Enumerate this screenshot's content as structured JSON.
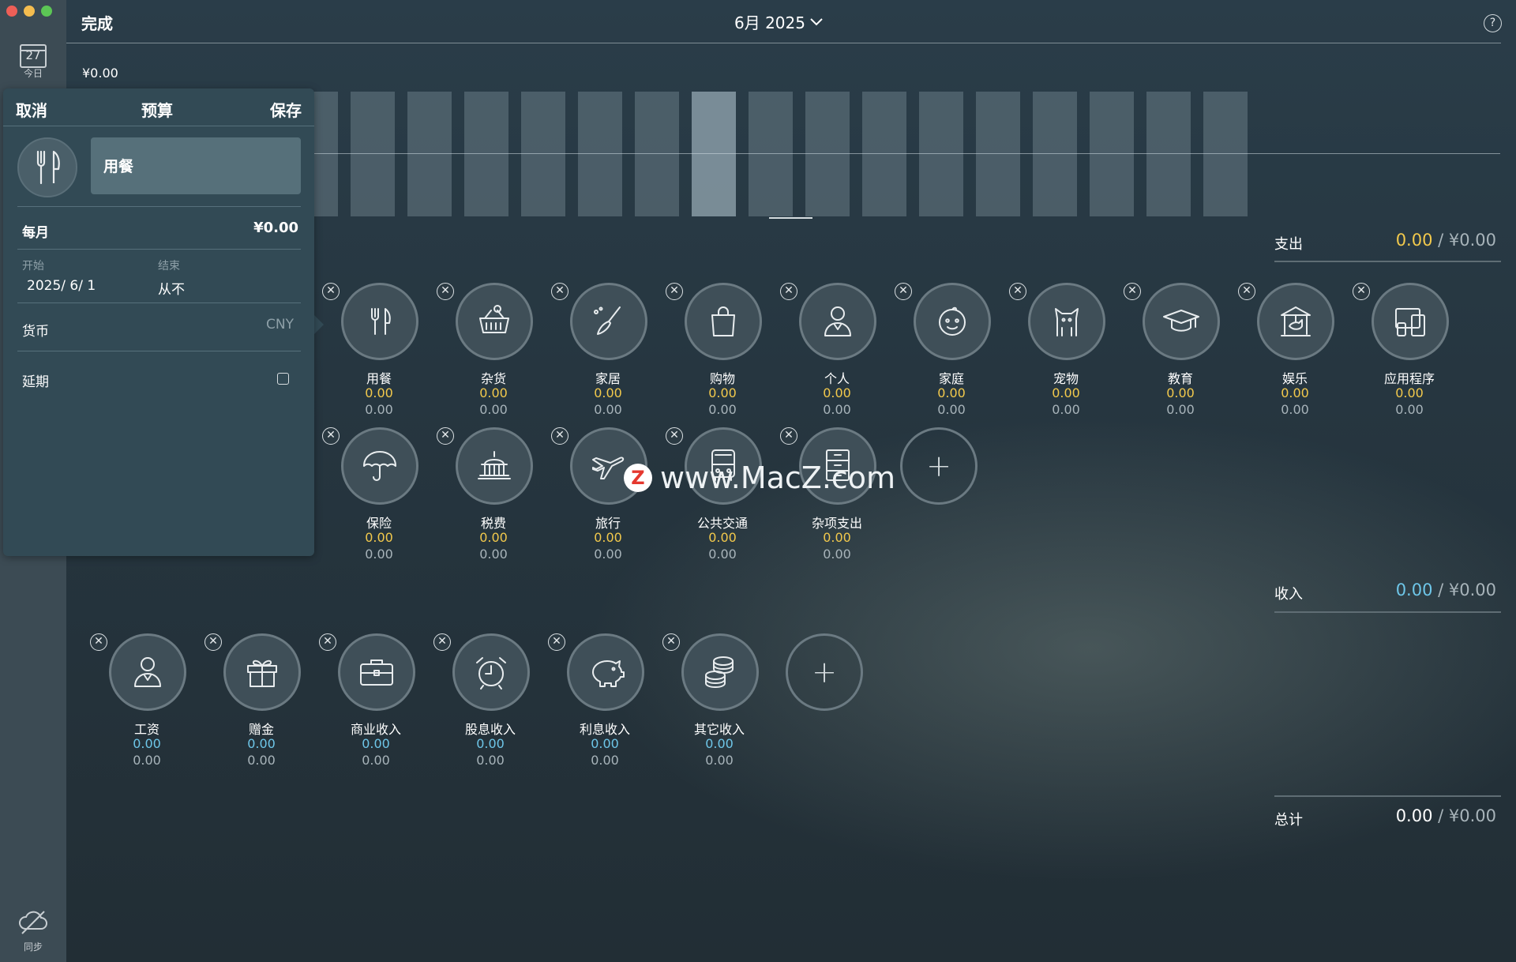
{
  "header": {
    "done_label": "完成",
    "month_label": "6月 2025",
    "help_label": "?"
  },
  "sidebar": {
    "today_day": "27",
    "today_label": "今日",
    "sync_label": "同步"
  },
  "daily_total": "¥0.00",
  "summary": {
    "expense": {
      "label": "支出",
      "spent": "0.00",
      "budget": " / ¥0.00"
    },
    "income": {
      "label": "收入",
      "spent": "0.00",
      "budget": " / ¥0.00"
    },
    "total": {
      "label": "总计",
      "spent": "0.00",
      "budget": " / ¥0.00"
    }
  },
  "expense_categories": [
    {
      "name": "用餐",
      "icon": "fork-knife-icon",
      "v1": "0.00",
      "v2": "0.00"
    },
    {
      "name": "杂货",
      "icon": "grocery-basket-icon",
      "v1": "0.00",
      "v2": "0.00"
    },
    {
      "name": "家居",
      "icon": "broom-icon",
      "v1": "0.00",
      "v2": "0.00"
    },
    {
      "name": "购物",
      "icon": "shopping-bag-icon",
      "v1": "0.00",
      "v2": "0.00"
    },
    {
      "name": "个人",
      "icon": "person-icon",
      "v1": "0.00",
      "v2": "0.00"
    },
    {
      "name": "家庭",
      "icon": "baby-face-icon",
      "v1": "0.00",
      "v2": "0.00"
    },
    {
      "name": "宠物",
      "icon": "cat-icon",
      "v1": "0.00",
      "v2": "0.00"
    },
    {
      "name": "教育",
      "icon": "graduation-cap-icon",
      "v1": "0.00",
      "v2": "0.00"
    },
    {
      "name": "娱乐",
      "icon": "carousel-icon",
      "v1": "0.00",
      "v2": "0.00"
    },
    {
      "name": "应用程序",
      "icon": "devices-icon",
      "v1": "0.00",
      "v2": "0.00"
    },
    {
      "name": "保险",
      "icon": "umbrella-icon",
      "v1": "0.00",
      "v2": "0.00"
    },
    {
      "name": "税费",
      "icon": "government-building-icon",
      "v1": "0.00",
      "v2": "0.00"
    },
    {
      "name": "旅行",
      "icon": "airplane-icon",
      "v1": "0.00",
      "v2": "0.00"
    },
    {
      "name": "公共交通",
      "icon": "bus-icon",
      "v1": "0.00",
      "v2": "0.00"
    },
    {
      "name": "杂项支出",
      "icon": "file-cabinet-icon",
      "v1": "0.00",
      "v2": "0.00"
    }
  ],
  "income_categories": [
    {
      "name": "工资",
      "icon": "person-icon",
      "v1": "0.00",
      "v2": "0.00"
    },
    {
      "name": "赠金",
      "icon": "gift-icon",
      "v1": "0.00",
      "v2": "0.00"
    },
    {
      "name": "商业收入",
      "icon": "briefcase-icon",
      "v1": "0.00",
      "v2": "0.00"
    },
    {
      "name": "股息收入",
      "icon": "alarm-clock-icon",
      "v1": "0.00",
      "v2": "0.00"
    },
    {
      "name": "利息收入",
      "icon": "piggy-bank-icon",
      "v1": "0.00",
      "v2": "0.00"
    },
    {
      "name": "其它收入",
      "icon": "coins-icon",
      "v1": "0.00",
      "v2": "0.00"
    }
  ],
  "budget_panel": {
    "cancel_label": "取消",
    "title": "预算",
    "save_label": "保存",
    "category_name": "用餐",
    "period_label": "每月",
    "amount": "¥0.00",
    "start_label": "开始",
    "start_value": "2025/ 6/  1",
    "end_label": "结束",
    "end_value": "从不",
    "currency_label": "货币",
    "currency_value": "CNY",
    "rollover_label": "延期"
  },
  "watermark": {
    "logo": "Z",
    "text": "www.MacZ.com"
  },
  "colors": {
    "expense_value": "#f2c94c",
    "income_value": "#6ec6e8",
    "bar": "#5a6f79",
    "panel": "#324a55"
  }
}
